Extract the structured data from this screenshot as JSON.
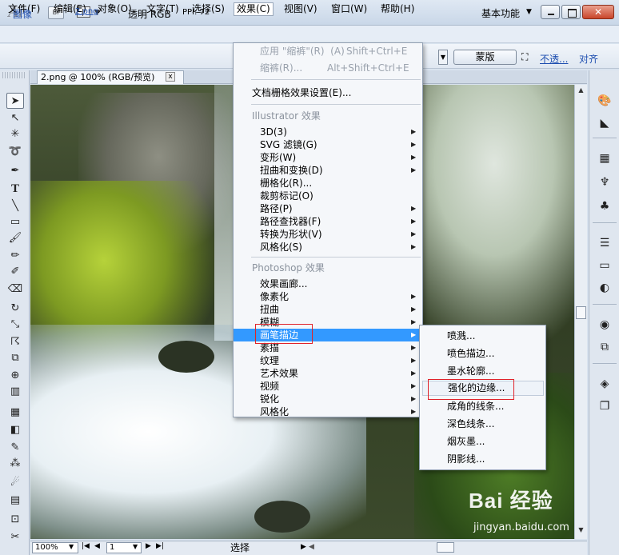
{
  "app": {
    "logo": "Ai",
    "bridge": "Br",
    "workspace": "基本功能",
    "close_glyph": "✕"
  },
  "menubar": [
    "文件(F)",
    "编辑(E)",
    "对象(O)",
    "文字(T)",
    "选择(S)",
    "效果(C)",
    "视图(V)",
    "窗口(W)",
    "帮助(H)"
  ],
  "controlbar": {
    "image_label": "图像",
    "file_link": "2.png",
    "transparency": "透明 RGB",
    "ppi": "PPI: 72",
    "mask_button": "蒙版",
    "opacity_link": "不透...",
    "align_link": "对齐"
  },
  "document": {
    "tab_title": "2.png @ 100% (RGB/预览)",
    "tab_close": "x"
  },
  "effect_menu": {
    "apply_last": "应用 \"缩裤\"(R)  (A)",
    "apply_last_shortcut": "Shift+Ctrl+E",
    "last_effect": "缩裤(R)...",
    "last_effect_shortcut": "Alt+Shift+Ctrl+E",
    "doc_raster_settings": "文档栅格效果设置(E)...",
    "illustrator_header": "Illustrator 效果",
    "illustrator_items": [
      "3D(3)",
      "SVG 滤镜(G)",
      "变形(W)",
      "扭曲和变换(D)",
      "栅格化(R)...",
      "裁剪标记(O)",
      "路径(P)",
      "路径查找器(F)",
      "转换为形状(V)",
      "风格化(S)"
    ],
    "photoshop_header": "Photoshop 效果",
    "photoshop_items": [
      "效果画廊...",
      "像素化",
      "扭曲",
      "模糊",
      "画笔描边",
      "素描",
      "纹理",
      "艺术效果",
      "视频",
      "锐化",
      "风格化"
    ],
    "highlighted": "画笔描边"
  },
  "submenu": {
    "items": [
      "喷溅...",
      "喷色描边...",
      "墨水轮廓...",
      "强化的边缘...",
      "成角的线条...",
      "深色线条...",
      "烟灰墨...",
      "阴影线..."
    ],
    "highlighted": "强化的边缘..."
  },
  "statusbar": {
    "zoom": "100%",
    "page": "1",
    "status_text": "选择"
  },
  "watermark": {
    "brand": "Bai 经验",
    "url": "jingyan.baidu.com"
  },
  "colors": {
    "highlight": "#3399ff",
    "red_annotation": "#e0232b",
    "link": "#1f4fb0"
  }
}
